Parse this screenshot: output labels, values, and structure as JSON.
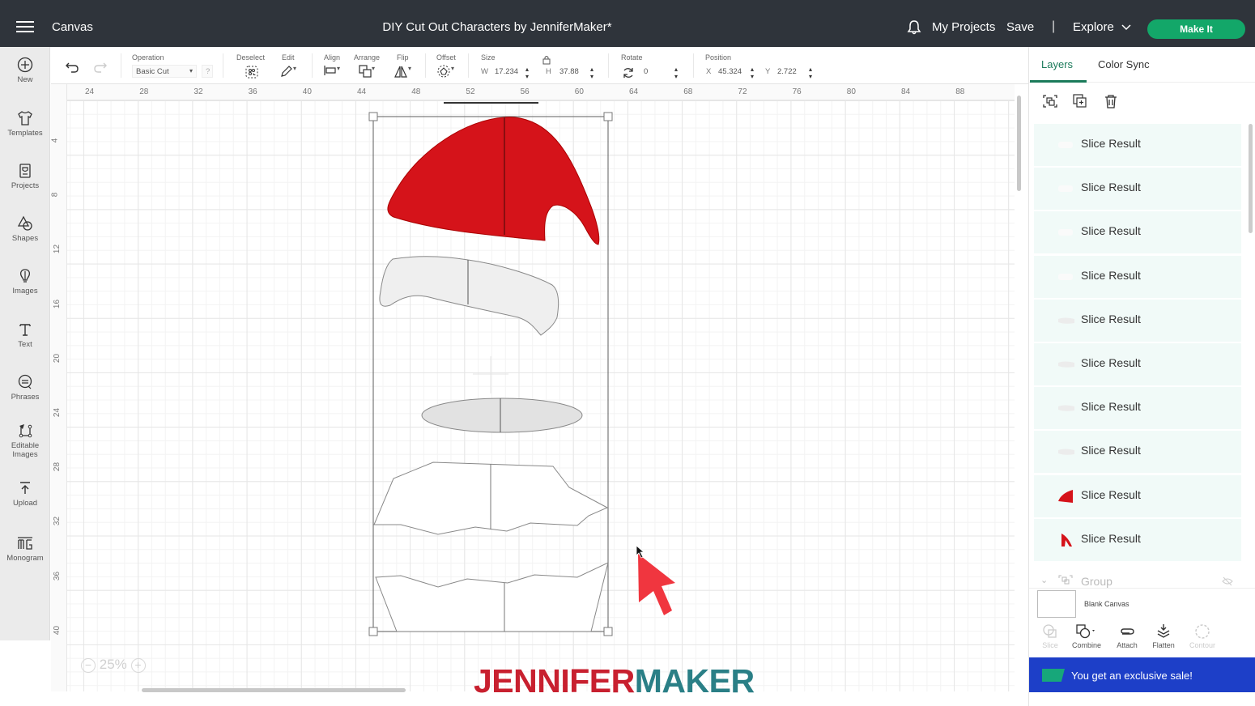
{
  "topbar": {
    "app_title": "Canvas",
    "doc_title": "DIY Cut Out Characters by JenniferMaker*",
    "my_projects": "My Projects",
    "save": "Save",
    "separator": "|",
    "explore": "Explore",
    "make_it": "Make It"
  },
  "leftnav": {
    "items": [
      {
        "label": "New",
        "icon": "plus-circle-icon"
      },
      {
        "label": "Templates",
        "icon": "tshirt-icon"
      },
      {
        "label": "Projects",
        "icon": "projects-card-icon"
      },
      {
        "label": "Shapes",
        "icon": "shapes-icon"
      },
      {
        "label": "Images",
        "icon": "lightbulb-balloon-icon"
      },
      {
        "label": "Text",
        "icon": "text-t-icon"
      },
      {
        "label": "Phrases",
        "icon": "speech-bubble-icon"
      },
      {
        "label": "Editable",
        "label2": "Images",
        "icon": "editable-images-icon"
      },
      {
        "label": "Upload",
        "icon": "upload-icon"
      },
      {
        "label": "Monogram",
        "icon": "monogram-icon"
      }
    ]
  },
  "toolbar": {
    "operation_label": "Operation",
    "operation_value": "Basic Cut",
    "help": "?",
    "deselect": "Deselect",
    "edit": "Edit",
    "align": "Align",
    "arrange": "Arrange",
    "flip": "Flip",
    "offset": "Offset",
    "size_label": "Size",
    "w_label": "W",
    "w_value": "17.234",
    "h_label": "H",
    "h_value": "37.88",
    "rotate_label": "Rotate",
    "rotate_value": "0",
    "position_label": "Position",
    "x_label": "X",
    "x_value": "45.324",
    "y_label": "Y",
    "y_value": "2.722"
  },
  "rulers": {
    "top": [
      "24",
      "28",
      "32",
      "36",
      "40",
      "44",
      "48",
      "52",
      "56",
      "60",
      "64",
      "68",
      "72",
      "76",
      "80",
      "84",
      "88"
    ],
    "left": [
      "4",
      "8",
      "12",
      "16",
      "20",
      "24",
      "28",
      "32",
      "36",
      "40"
    ]
  },
  "canvas": {
    "zoom": "25%",
    "watermark_part1": "JENNIFER",
    "watermark_part2": "MAKER",
    "colors": {
      "hat_red": "#d5131a",
      "brim_gray": "#efefef",
      "ellipse_gray": "#e2e2e2",
      "arrow_red": "#f0363f"
    }
  },
  "rpanel": {
    "tabs": [
      {
        "label": "Layers",
        "active": true
      },
      {
        "label": "Color Sync",
        "active": false
      }
    ],
    "layers": [
      {
        "name": "Slice Result",
        "thumb": "white"
      },
      {
        "name": "Slice Result",
        "thumb": "white"
      },
      {
        "name": "Slice Result",
        "thumb": "white"
      },
      {
        "name": "Slice Result",
        "thumb": "white"
      },
      {
        "name": "Slice Result",
        "thumb": "light-gray"
      },
      {
        "name": "Slice Result",
        "thumb": "light-gray"
      },
      {
        "name": "Slice Result",
        "thumb": "light-gray"
      },
      {
        "name": "Slice Result",
        "thumb": "light-gray"
      },
      {
        "name": "Slice Result",
        "thumb": "red"
      },
      {
        "name": "Slice Result",
        "thumb": "red"
      }
    ],
    "group_label": "Group",
    "blank_canvas": "Blank Canvas",
    "bottom_tools": [
      {
        "label": "Slice",
        "enabled": false
      },
      {
        "label": "Combine",
        "enabled": true
      },
      {
        "label": "Attach",
        "enabled": true
      },
      {
        "label": "Flatten",
        "enabled": true
      },
      {
        "label": "Contour",
        "enabled": false
      }
    ],
    "promo": "You get an exclusive sale!"
  }
}
